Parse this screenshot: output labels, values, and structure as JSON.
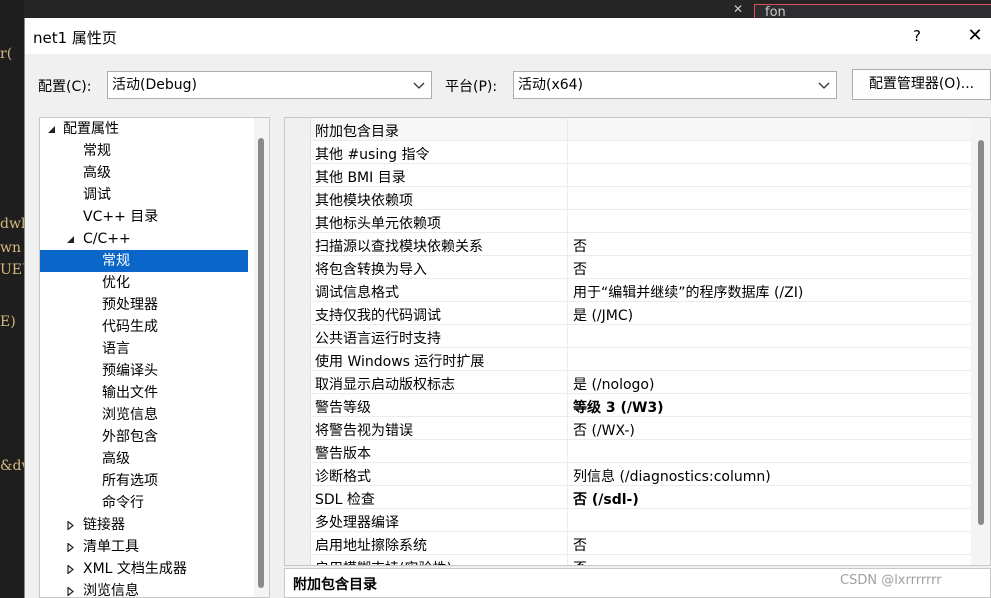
{
  "background": {
    "editor_fragments": [
      "r(",
      "dwl",
      "wn",
      "UEU",
      "E)",
      "&dw"
    ],
    "search_text": "fon"
  },
  "dialog": {
    "title": "net1 属性页",
    "help_glyph": "?",
    "close_glyph": "✕"
  },
  "config": {
    "config_label": "配置(C):",
    "config_value": "活动(Debug)",
    "platform_label": "平台(P):",
    "platform_value": "活动(x64)",
    "manager_button": "配置管理器(O)..."
  },
  "tree": {
    "items": [
      {
        "label": "配置属性",
        "expander": "expanded",
        "selected": false
      },
      {
        "label": "常规",
        "expander": "none",
        "selected": false
      },
      {
        "label": "高级",
        "expander": "none",
        "selected": false
      },
      {
        "label": "调试",
        "expander": "none",
        "selected": false
      },
      {
        "label": "VC++ 目录",
        "expander": "none",
        "selected": false
      },
      {
        "label": "C/C++",
        "expander": "expanded",
        "selected": false
      },
      {
        "label": "常规",
        "expander": "none",
        "selected": true
      },
      {
        "label": "优化",
        "expander": "none",
        "selected": false
      },
      {
        "label": "预处理器",
        "expander": "none",
        "selected": false
      },
      {
        "label": "代码生成",
        "expander": "none",
        "selected": false
      },
      {
        "label": "语言",
        "expander": "none",
        "selected": false
      },
      {
        "label": "预编译头",
        "expander": "none",
        "selected": false
      },
      {
        "label": "输出文件",
        "expander": "none",
        "selected": false
      },
      {
        "label": "浏览信息",
        "expander": "none",
        "selected": false
      },
      {
        "label": "外部包含",
        "expander": "none",
        "selected": false
      },
      {
        "label": "高级",
        "expander": "none",
        "selected": false
      },
      {
        "label": "所有选项",
        "expander": "none",
        "selected": false
      },
      {
        "label": "命令行",
        "expander": "none",
        "selected": false
      },
      {
        "label": "链接器",
        "expander": "collapsed",
        "selected": false
      },
      {
        "label": "清单工具",
        "expander": "collapsed",
        "selected": false
      },
      {
        "label": "XML 文档生成器",
        "expander": "collapsed",
        "selected": false
      },
      {
        "label": "浏览信息",
        "expander": "collapsed",
        "selected": false
      }
    ]
  },
  "properties": {
    "rows": [
      {
        "name": "附加包含目录",
        "value": "",
        "bold": false
      },
      {
        "name": "其他 #using 指令",
        "value": "",
        "bold": false
      },
      {
        "name": "其他 BMI 目录",
        "value": "",
        "bold": false
      },
      {
        "name": "其他模块依赖项",
        "value": "",
        "bold": false
      },
      {
        "name": "其他标头单元依赖项",
        "value": "",
        "bold": false
      },
      {
        "name": "扫描源以查找模块依赖关系",
        "value": "否",
        "bold": false
      },
      {
        "name": "将包含转换为导入",
        "value": "否",
        "bold": false
      },
      {
        "name": "调试信息格式",
        "value": "用于“编辑并继续”的程序数据库 (/ZI)",
        "bold": false
      },
      {
        "name": "支持仅我的代码调试",
        "value": "是 (/JMC)",
        "bold": false
      },
      {
        "name": "公共语言运行时支持",
        "value": "",
        "bold": false
      },
      {
        "name": "使用 Windows 运行时扩展",
        "value": "",
        "bold": false
      },
      {
        "name": "取消显示启动版权标志",
        "value": "是 (/nologo)",
        "bold": false
      },
      {
        "name": "警告等级",
        "value": "等级 3 (/W3)",
        "bold": true
      },
      {
        "name": "将警告视为错误",
        "value": "否 (/WX-)",
        "bold": false
      },
      {
        "name": "警告版本",
        "value": "",
        "bold": false
      },
      {
        "name": "诊断格式",
        "value": "列信息 (/diagnostics:column)",
        "bold": false
      },
      {
        "name": "SDL 检查",
        "value": "否 (/sdl-)",
        "bold": true
      },
      {
        "name": "多处理器编译",
        "value": "",
        "bold": false
      },
      {
        "name": "启用地址擦除系统",
        "value": "否",
        "bold": false
      },
      {
        "name": "启用模糊支持(实验性)",
        "value": "否",
        "bold": false
      }
    ]
  },
  "description": {
    "title": "附加包含目录"
  },
  "watermark": "CSDN @lxrrrrrrr",
  "colors": {
    "selection": "#0a66c8",
    "dialog_bg": "#f0f0f0"
  }
}
